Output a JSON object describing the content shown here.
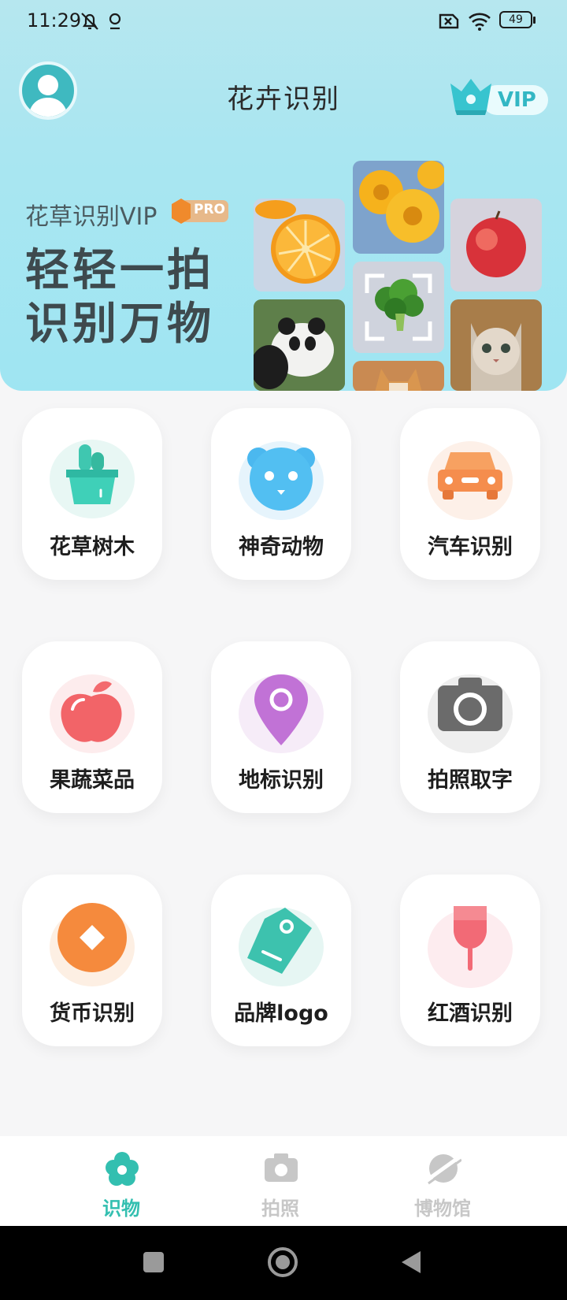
{
  "status_bar": {
    "time": "11:29",
    "battery": "49"
  },
  "header": {
    "title": "花卉识别",
    "vip_label": "VIP"
  },
  "promo": {
    "subtitle": "花草识别VIP",
    "pro_label": "PRO",
    "headline_line1": "轻轻一拍",
    "headline_line2": "识别万物"
  },
  "grid": [
    {
      "label": "花草树木",
      "icon": "flower-pot-icon"
    },
    {
      "label": "神奇动物",
      "icon": "bear-icon"
    },
    {
      "label": "汽车识别",
      "icon": "car-icon"
    },
    {
      "label": "果蔬菜品",
      "icon": "apple-icon"
    },
    {
      "label": "地标识别",
      "icon": "location-pin-icon"
    },
    {
      "label": "拍照取字",
      "icon": "camera-icon"
    },
    {
      "label": "货币识别",
      "icon": "coin-icon"
    },
    {
      "label": "品牌logo",
      "icon": "tag-icon"
    },
    {
      "label": "红酒识别",
      "icon": "wine-glass-icon"
    }
  ],
  "bottom_nav": [
    {
      "label": "识物",
      "icon": "flower-icon",
      "active": true
    },
    {
      "label": "拍照",
      "icon": "camera-icon",
      "active": false
    },
    {
      "label": "博物馆",
      "icon": "planet-icon",
      "active": false
    }
  ],
  "colors": {
    "accent": "#33bfb0",
    "inactive": "#c7c7c7",
    "hero_bg": "#a9e6f1"
  }
}
